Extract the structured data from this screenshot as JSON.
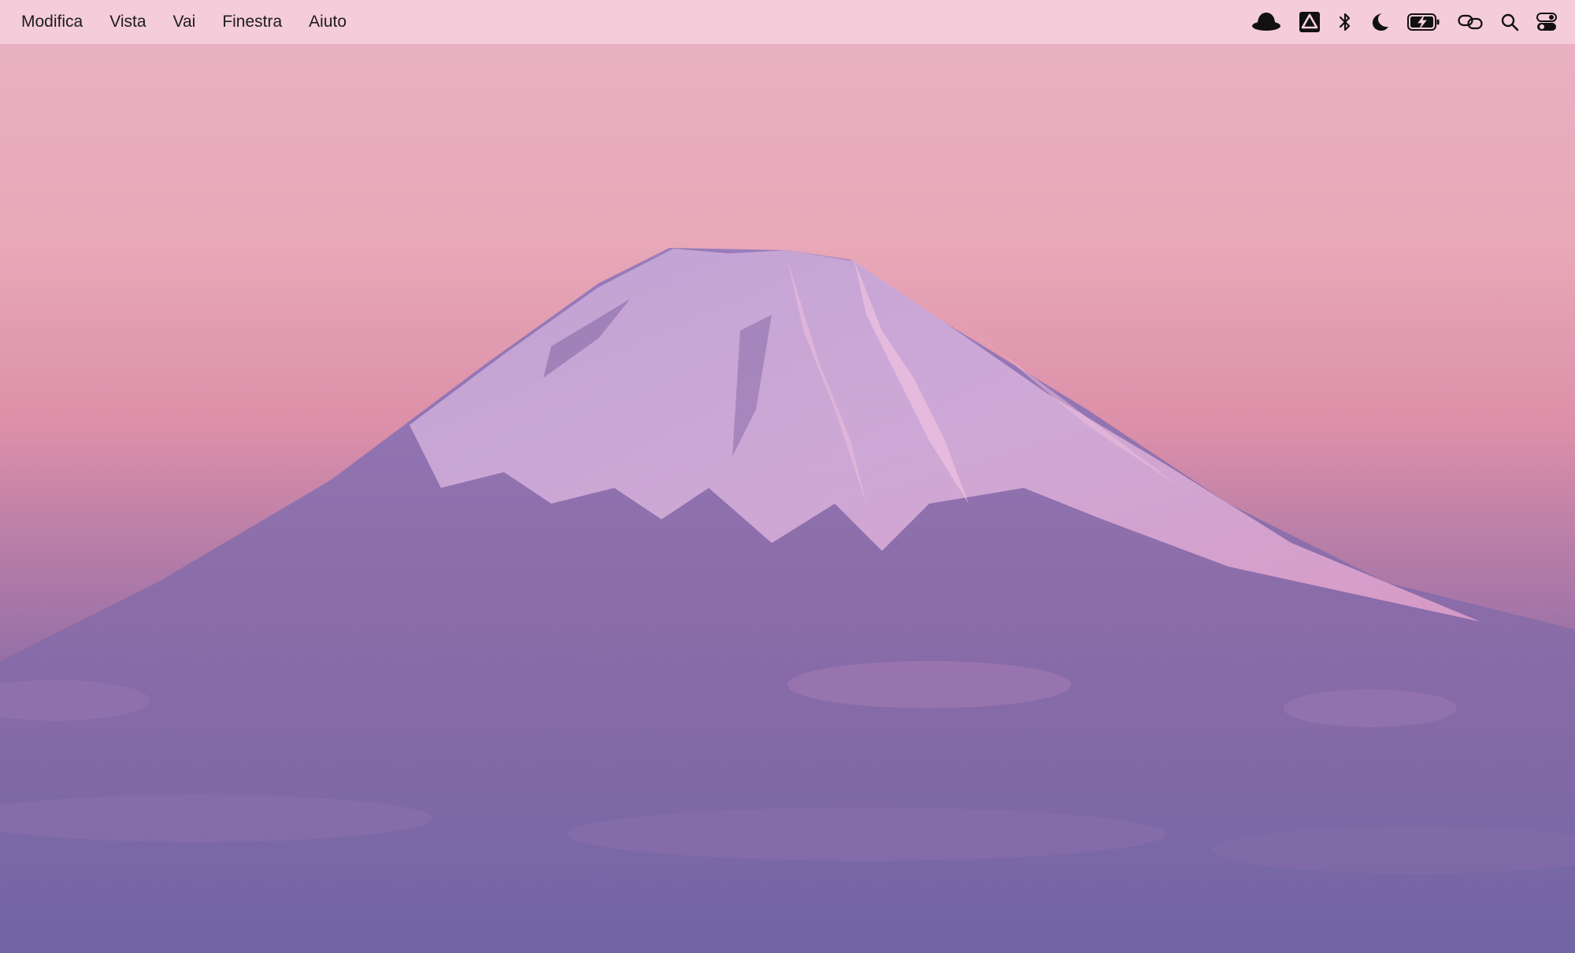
{
  "menubar": {
    "items": [
      {
        "label": "Modifica"
      },
      {
        "label": "Vista"
      },
      {
        "label": "Vai"
      },
      {
        "label": "Finestra"
      },
      {
        "label": "Aiuto"
      }
    ],
    "status_icons": [
      "bowler-hat-icon",
      "google-drive-icon",
      "bluetooth-icon",
      "moon-icon",
      "battery-charging-icon",
      "link-icon",
      "search-icon",
      "control-center-icon"
    ]
  },
  "colors": {
    "menubar_bg": "#f8d2de",
    "sky_top": "#e9b2c4",
    "sky_horizon": "#dc8fa8",
    "mountain": "#8a6fae",
    "snow": "#d6b8e0",
    "clouds": "#7a6aa8"
  }
}
